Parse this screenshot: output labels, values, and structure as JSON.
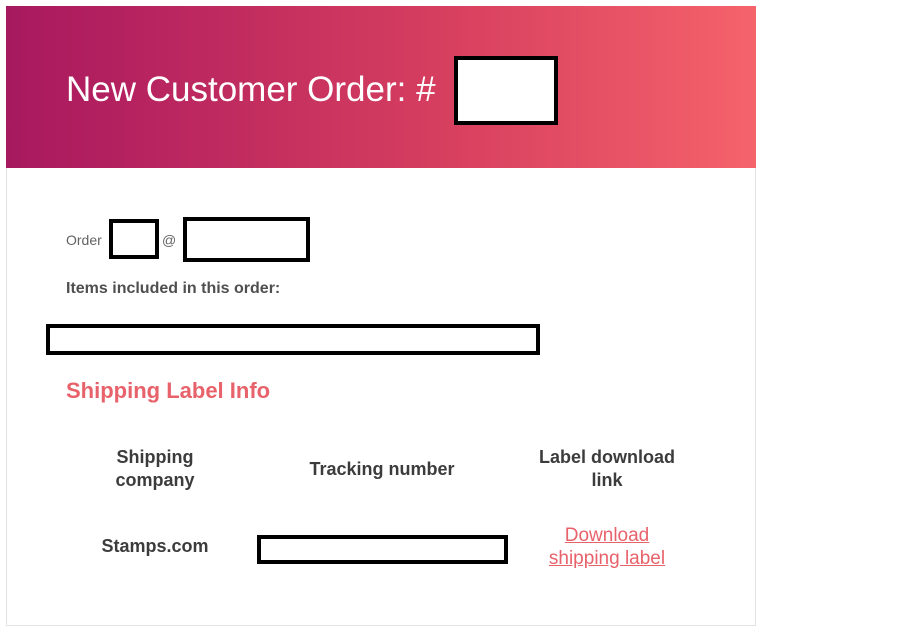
{
  "header": {
    "title": "New Customer Order: #"
  },
  "order": {
    "prefix": "Order",
    "at": "@"
  },
  "items": {
    "heading": "Items included in this order:"
  },
  "shipping": {
    "heading": "Shipping Label Info",
    "columns": [
      "Shipping company",
      "Tracking number",
      "Label download link"
    ],
    "rows": [
      {
        "company": "Stamps.com",
        "tracking": "",
        "link_label": "Download shipping label"
      }
    ]
  },
  "colors": {
    "header_gradient_start": "#a7195f",
    "header_gradient_end": "#f5636b",
    "accent": "#e8626b",
    "redaction": "#000000"
  }
}
